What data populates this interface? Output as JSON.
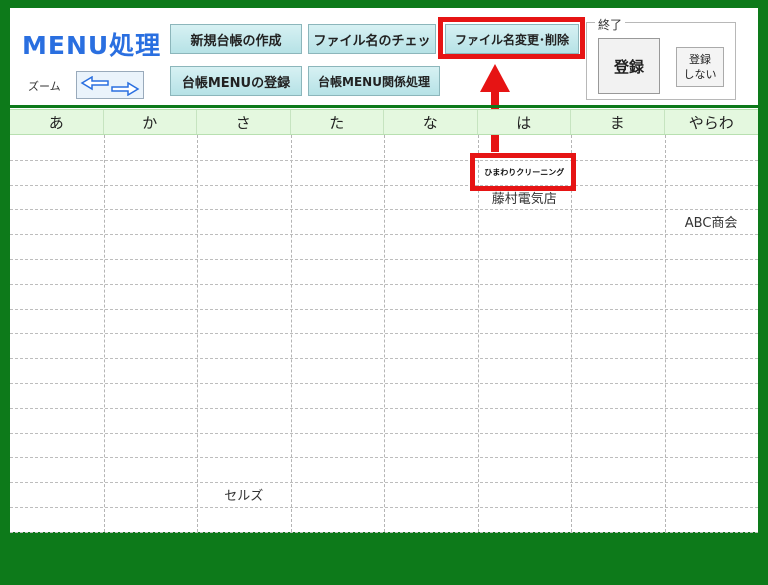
{
  "title": "MENU処理",
  "zoom": {
    "label": "ズーム"
  },
  "buttons": {
    "new_ledger": "新規台帳の作成",
    "file_check": "ファイル名のチェッ",
    "rename_delete": "ファイル名変更･削除",
    "register_menu": "台帳MENUの登録",
    "menu_related": "台帳MENU関係処理"
  },
  "exit": {
    "legend": "終了",
    "save": "登録",
    "no_save": "登録\nしない"
  },
  "columns": [
    "あ",
    "か",
    "さ",
    "た",
    "な",
    "は",
    "ま",
    "やらわ"
  ],
  "entries": [
    {
      "col": 5,
      "row": 1,
      "text": "ひまわりクリーニング"
    },
    {
      "col": 5,
      "row": 2,
      "text": "藤村電気店"
    },
    {
      "col": 7,
      "row": 3,
      "text": "ABC商会"
    },
    {
      "col": 2,
      "row": 14,
      "text": "セルズ"
    }
  ],
  "colors": {
    "frame": "#0d7a1a",
    "title": "#2a6fe0",
    "highlight": "#e61414",
    "header_bg": "#e4f8df"
  }
}
